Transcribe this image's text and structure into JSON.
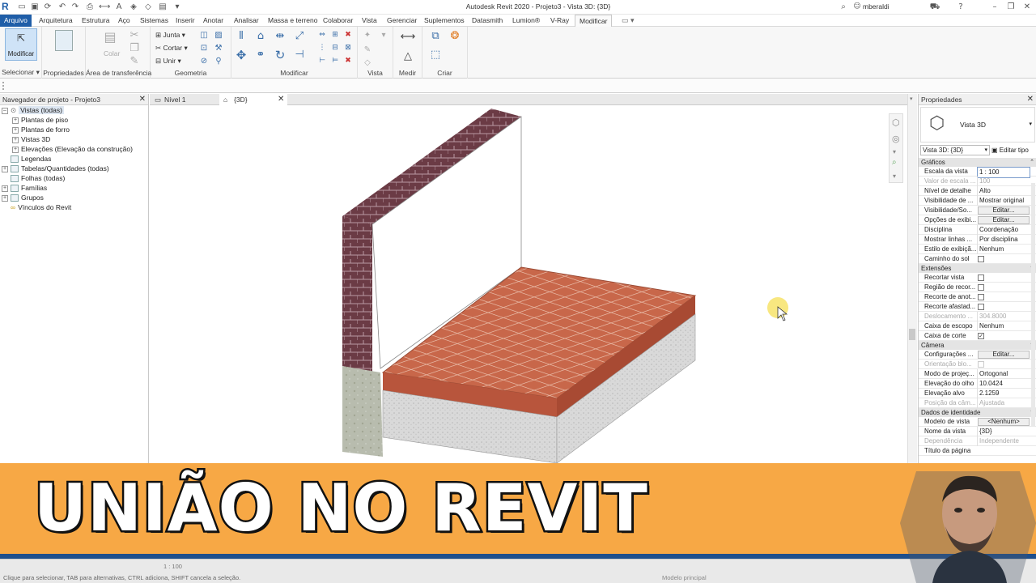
{
  "window": {
    "title": "Autodesk Revit 2020 - Projeto3 - Vista 3D: {3D}",
    "user": "mberaldi"
  },
  "menu": {
    "tabs": [
      {
        "label": "Arquivo"
      },
      {
        "label": "Arquitetura"
      },
      {
        "label": "Estrutura"
      },
      {
        "label": "Aço"
      },
      {
        "label": "Sistemas"
      },
      {
        "label": "Inserir"
      },
      {
        "label": "Anotar"
      },
      {
        "label": "Analisar"
      },
      {
        "label": "Massa e terreno"
      },
      {
        "label": "Colaborar"
      },
      {
        "label": "Vista"
      },
      {
        "label": "Gerenciar"
      },
      {
        "label": "Suplementos"
      },
      {
        "label": "Datasmith"
      },
      {
        "label": "Lumion®"
      },
      {
        "label": "V-Ray"
      },
      {
        "label": "Modificar"
      }
    ],
    "active": "Modificar"
  },
  "ribbon": {
    "modify_label": "Modificar",
    "paste_label": "Colar",
    "geometry": {
      "join": "Junta",
      "cut": "Cortar",
      "unite": "Unir"
    },
    "groups": {
      "select": "Selecionar",
      "properties": "Propriedades",
      "clipboard": "Área de transferência",
      "geometry": "Geometria",
      "modify": "Modificar",
      "view": "Vista",
      "measure": "Medir",
      "create": "Criar"
    }
  },
  "navigator": {
    "title": "Navegador de projeto - Projeto3",
    "items": [
      {
        "label": "Vistas (todas)"
      },
      {
        "label": "Plantas de piso"
      },
      {
        "label": "Plantas de forro"
      },
      {
        "label": "Vistas 3D"
      },
      {
        "label": "Elevações (Elevação da construção)"
      },
      {
        "label": "Legendas"
      },
      {
        "label": "Tabelas/Quantidades (todas)"
      },
      {
        "label": "Folhas (todas)"
      },
      {
        "label": "Famílias"
      },
      {
        "label": "Grupos"
      },
      {
        "label": "Vínculos do Revit"
      }
    ]
  },
  "view_tabs": [
    {
      "label": "Nível 1"
    },
    {
      "label": "{3D}"
    }
  ],
  "properties": {
    "title": "Propriedades",
    "type_name": "Vista 3D",
    "selector": "Vista 3D: {3D}",
    "edit_type": "Editar tipo",
    "sections": {
      "graphics": "Gráficos",
      "extents": "Extensões",
      "camera": "Câmera",
      "identity": "Dados de identidade"
    },
    "rows": {
      "scale": {
        "key": "Escala da vista",
        "value": "1 : 100"
      },
      "scale_value": {
        "key": "Valor de escala ...",
        "value": "100"
      },
      "detail": {
        "key": "Nível de detalhe",
        "value": "Alto"
      },
      "vis_parts": {
        "key": "Visibilidade de ...",
        "value": "Mostrar original"
      },
      "vis_graphics": {
        "key": "Visibilidade/So...",
        "value": "Editar..."
      },
      "display_opts": {
        "key": "Opções de exibi...",
        "value": "Editar..."
      },
      "discipline": {
        "key": "Disciplina",
        "value": "Coordenação"
      },
      "show_hidden": {
        "key": "Mostrar linhas ...",
        "value": "Por disciplina"
      },
      "display_style": {
        "key": "Estilo de exibiçã...",
        "value": "Nenhum"
      },
      "sun_path": {
        "key": "Caminho do sol",
        "checked": false
      },
      "crop_view": {
        "key": "Recortar vista",
        "checked": false
      },
      "crop_region": {
        "key": "Região de recor...",
        "checked": false
      },
      "annot_crop": {
        "key": "Recorte de anot...",
        "checked": false
      },
      "far_clip": {
        "key": "Recorte afastad...",
        "checked": false
      },
      "far_offset": {
        "key": "Deslocamento ...",
        "value": "304.8000"
      },
      "scope_box": {
        "key": "Caixa de escopo",
        "value": "Nenhum"
      },
      "section_box": {
        "key": "Caixa de corte",
        "checked": true
      },
      "render_settings": {
        "key": "Configurações ...",
        "value": "Editar..."
      },
      "lock_orient": {
        "key": "Orientação blo...",
        "checked": false
      },
      "projection": {
        "key": "Modo de projeç...",
        "value": "Ortogonal"
      },
      "eye_elev": {
        "key": "Elevação do olho",
        "value": "10.0424"
      },
      "target_elev": {
        "key": "Elevação alvo",
        "value": "2.1259"
      },
      "camera_pos": {
        "key": "Posição da câm...",
        "value": "Ajustada"
      },
      "view_template": {
        "key": "Modelo de vista",
        "value": "<Nenhum>"
      },
      "view_name": {
        "key": "Nome da vista",
        "value": "{3D}"
      },
      "dependency": {
        "key": "Dependência",
        "value": "Independente"
      },
      "page_title": {
        "key": "Título da página",
        "value": ""
      }
    }
  },
  "status": {
    "hint": "Clique para selecionar, TAB para alternativas, CTRL adiciona, SHIFT cancela a seleção.",
    "scale": "1 : 100",
    "model": "Modelo principal"
  },
  "banner": {
    "text": "UNIÃO NO REVIT",
    "color": "#f7a845",
    "stripe_color": "#1e4f8c"
  },
  "colors": {
    "accent": "#1f5ea8",
    "floor_tile": "#c0603f",
    "wall_brick": "#6b3b45"
  }
}
